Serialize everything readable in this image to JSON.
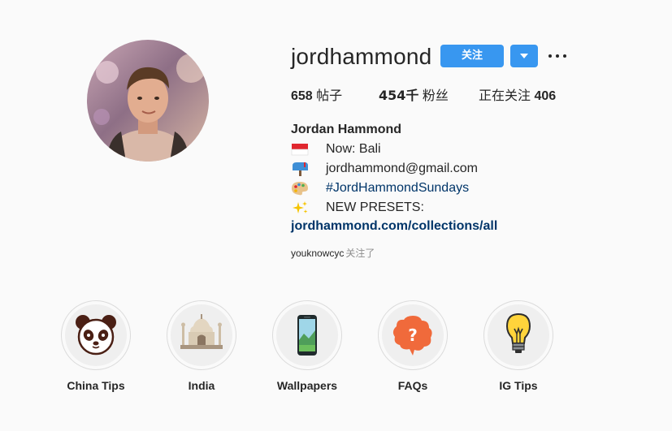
{
  "profile": {
    "username": "jordhammond",
    "follow_label": "关注",
    "full_name": "Jordan Hammond"
  },
  "stats": {
    "posts_count": "658",
    "posts_label": "帖子",
    "followers_count": "454千",
    "followers_label": "粉丝",
    "following_label": "正在关注",
    "following_count": "406"
  },
  "bio": {
    "lines": [
      {
        "icon": "indonesia-flag-icon",
        "text": "Now: Bali"
      },
      {
        "icon": "mailbox-icon",
        "text": "jordhammond@gmail.com"
      },
      {
        "icon": "palette-icon",
        "text": "#JordHammondSundays"
      },
      {
        "icon": "sparkles-icon",
        "text": "NEW PRESETS:"
      }
    ],
    "website": "jordhammond.com/collections/all"
  },
  "followed_by": {
    "user": "youknowcyc",
    "suffix": "关注了"
  },
  "highlights": [
    {
      "label": "China Tips",
      "icon": "panda-icon"
    },
    {
      "label": "India",
      "icon": "taj-mahal-icon"
    },
    {
      "label": "Wallpapers",
      "icon": "phone-wallpaper-icon"
    },
    {
      "label": "FAQs",
      "icon": "question-bubble-icon"
    },
    {
      "label": "IG Tips",
      "icon": "lightbulb-icon"
    }
  ],
  "colors": {
    "accent": "#3897f0",
    "link": "#003569",
    "text": "#262626",
    "muted": "#8e8e8e",
    "background": "#fafafa"
  }
}
